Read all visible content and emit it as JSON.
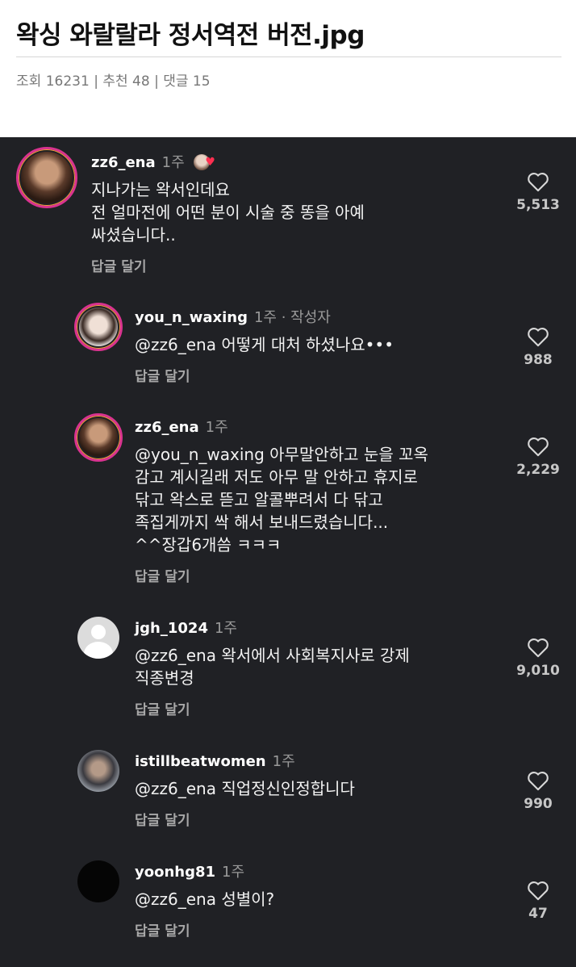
{
  "post": {
    "title": "왁싱 와랄랄라 정서역전 버전.jpg",
    "views_label": "조회",
    "views": "16231",
    "likes_label": "추천",
    "likes": "48",
    "comments_label": "댓글",
    "comments": "15"
  },
  "reply_label": "답글 달기",
  "colors": {
    "background": "#202125",
    "heart": "#d8d8d8",
    "ring": "#d9338f"
  },
  "comments": [
    {
      "username": "zz6_ena",
      "time": "1주",
      "text": "지나가는 왁서인데요\n전 얼마전에 어떤 분이 시술 중 똥을 아예\n싸셨습니다..",
      "likes": "5,513",
      "creator_heart": "red-heart-icon"
    },
    {
      "username": "you_n_waxing",
      "time": "1주",
      "author_tag": "· 작성자",
      "text": "@zz6_ena 어떻게 대처 하셨나요•••",
      "likes": "988"
    },
    {
      "username": "zz6_ena",
      "time": "1주",
      "text": "@you_n_waxing 아무말안하고 눈을 꼬옥\n감고 계시길래 저도 아무 말 안하고 휴지로\n닦고 왁스로 뜯고 알콜뿌려서 다 닦고\n족집게까지 싹 해서 보내드렸습니다...\n^^장갑6개씀 ㅋㅋㅋ",
      "likes": "2,229"
    },
    {
      "username": "jgh_1024",
      "time": "1주",
      "text": "@zz6_ena 왁서에서 사회복지사로 강제\n직종변경",
      "likes": "9,010"
    },
    {
      "username": "istillbeatwomen",
      "time": "1주",
      "text": "@zz6_ena 직업정신인정합니다",
      "likes": "990"
    },
    {
      "username": "yoonhg81",
      "time": "1주",
      "text": "@zz6_ena 성별이?",
      "likes": "47"
    }
  ]
}
